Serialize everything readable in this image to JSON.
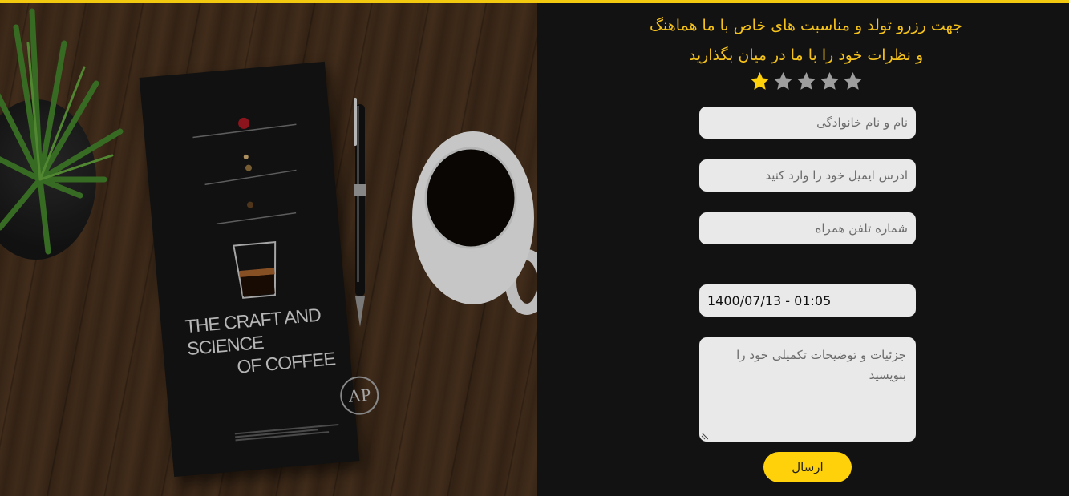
{
  "booking_form": {
    "heading_line1": "جهت رزرو تولد و مناسبت های خاص با ما هماهنگ",
    "heading_line2": "و نظرات خود را با ما در میان بگذارید",
    "rating": {
      "value": 1,
      "max": 5,
      "active_color": "#ffd10a",
      "inactive_color": "#9e9e9e"
    },
    "name_placeholder": "نام و نام خانوادگی",
    "email_placeholder": "ادرس ایمیل خود را وارد کنید",
    "phone_placeholder": "شماره تلفن همراه",
    "datetime_value": "1400/07/13 - 01:05",
    "details_placeholder_line1": "جزئیات و توضیحات تکمیلی خود را",
    "details_placeholder_line2": "بنویسید",
    "submit_label": "ارسال"
  },
  "hero_image": {
    "book_title_line1": "THE CRAFT AND SCIENCE",
    "book_title_line2": "OF COFFEE",
    "publisher_logo": "AP"
  },
  "colors": {
    "accent": "#f2c90f",
    "heading": "#f5c21b",
    "background": "#121212",
    "field_background": "#e9e9ea"
  }
}
